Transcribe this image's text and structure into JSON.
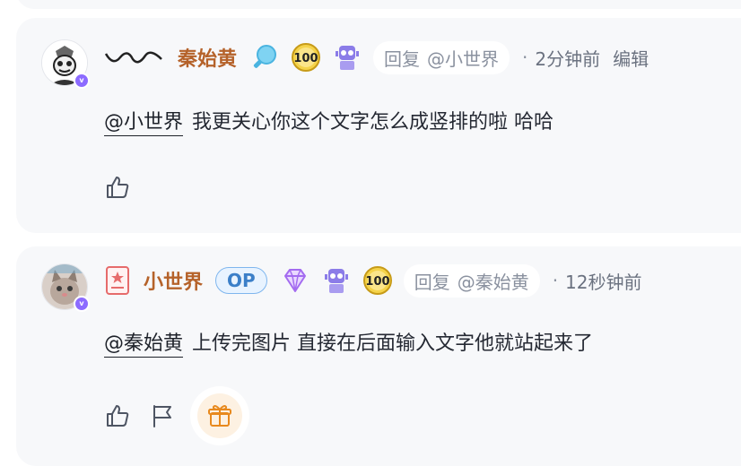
{
  "comments": [
    {
      "username": "秦始黄",
      "badges": [
        "magnifier-badge-icon",
        "hundred-badge-icon",
        "robot-badge-icon"
      ],
      "reply_label": "回复",
      "reply_target": "@小世界",
      "separator": "·",
      "time": "2分钟前",
      "edit_label": "编辑",
      "mention": "@小世界",
      "text": "我更关心你这个文字怎么成竖排的啦 哈哈",
      "actions": [
        "thumbs-up-icon"
      ]
    },
    {
      "username": "小世界",
      "op_badge": "OP",
      "badges": [
        "diamond-badge-icon",
        "robot-badge-icon",
        "hundred-badge-icon"
      ],
      "reply_label": "回复",
      "reply_target": "@秦始黄",
      "separator": "·",
      "time": "12秒钟前",
      "mention": "@秦始黄",
      "text": "上传完图片 直接在后面输入文字他就站起来了",
      "actions": [
        "thumbs-up-icon",
        "flag-icon",
        "gift-icon"
      ]
    }
  ],
  "colors": {
    "username": "#b5622a",
    "op_badge": "#3b7fc8",
    "card_bg": "#f7f8fa",
    "meta_text": "#8a919f",
    "vip": "#8c6bff"
  }
}
